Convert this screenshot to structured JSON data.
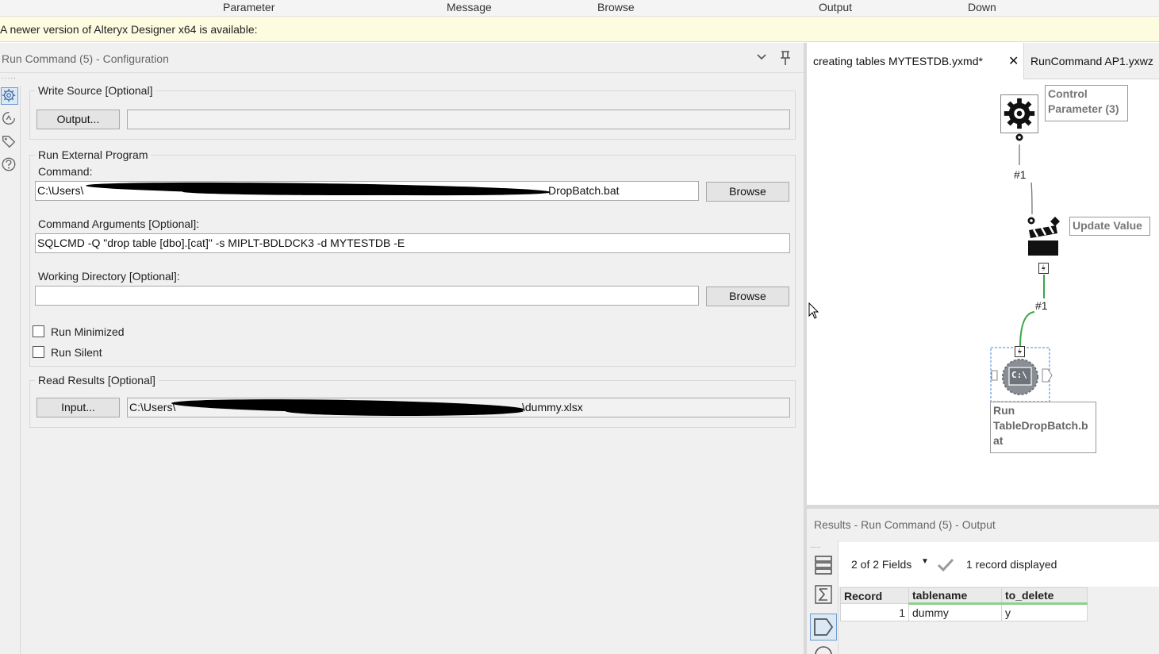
{
  "ribbon": {
    "items": [
      "Parameter",
      "Message",
      "Browse",
      "Output",
      "Down"
    ]
  },
  "notice": {
    "text": "A newer version of Alteryx Designer x64 is available:"
  },
  "config": {
    "title": "Run Command (5) - Configuration",
    "write_source": {
      "legend": "Write Source [Optional]",
      "button": "Output...",
      "value": ""
    },
    "run_external": {
      "legend": "Run External Program",
      "command_label": "Command:",
      "command_prefix": "C:\\Users\\",
      "command_suffix": "DropBatch.bat",
      "browse": "Browse",
      "args_label": "Command Arguments [Optional]:",
      "args_value": "SQLCMD -Q \"drop table [dbo].[cat]\" -s MIPLT-BDLDCK3 -d MYTESTDB -E",
      "workdir_label": "Working Directory [Optional]:",
      "workdir_value": "",
      "browse2": "Browse",
      "run_minimized": "Run Minimized",
      "run_silent": "Run Silent"
    },
    "read_results": {
      "legend": "Read Results [Optional]",
      "button": "Input...",
      "path_prefix": "C:\\Users\\",
      "path_suffix": "\\dummy.xlsx"
    }
  },
  "canvas": {
    "tabs": [
      {
        "label": "creating tables MYTESTDB.yxmd*",
        "close": "✕"
      },
      {
        "label": "RunCommand AP1.yxwz"
      }
    ],
    "tools": {
      "control_parameter": "Control\nParameter (3)",
      "update_value": "Update Value",
      "run_tool": "Run\nTableDropBatch.b\nat",
      "run_icon_text": "C:\\"
    },
    "connections": [
      "#1",
      "#1"
    ]
  },
  "results": {
    "title": "Results - Run Command (5) - Output",
    "fields": "2 of 2 Fields",
    "records": "1 record displayed",
    "columns": [
      "Record",
      "tablename",
      "to_delete"
    ],
    "rows": [
      {
        "record": "1",
        "tablename": "dummy",
        "to_delete": "y"
      }
    ]
  },
  "colors": {
    "notice_bg": "#fdfbe0",
    "accent_blue": "#6f9ac9",
    "connector_green": "#3aa64a",
    "check_green": "#8ed08e"
  }
}
